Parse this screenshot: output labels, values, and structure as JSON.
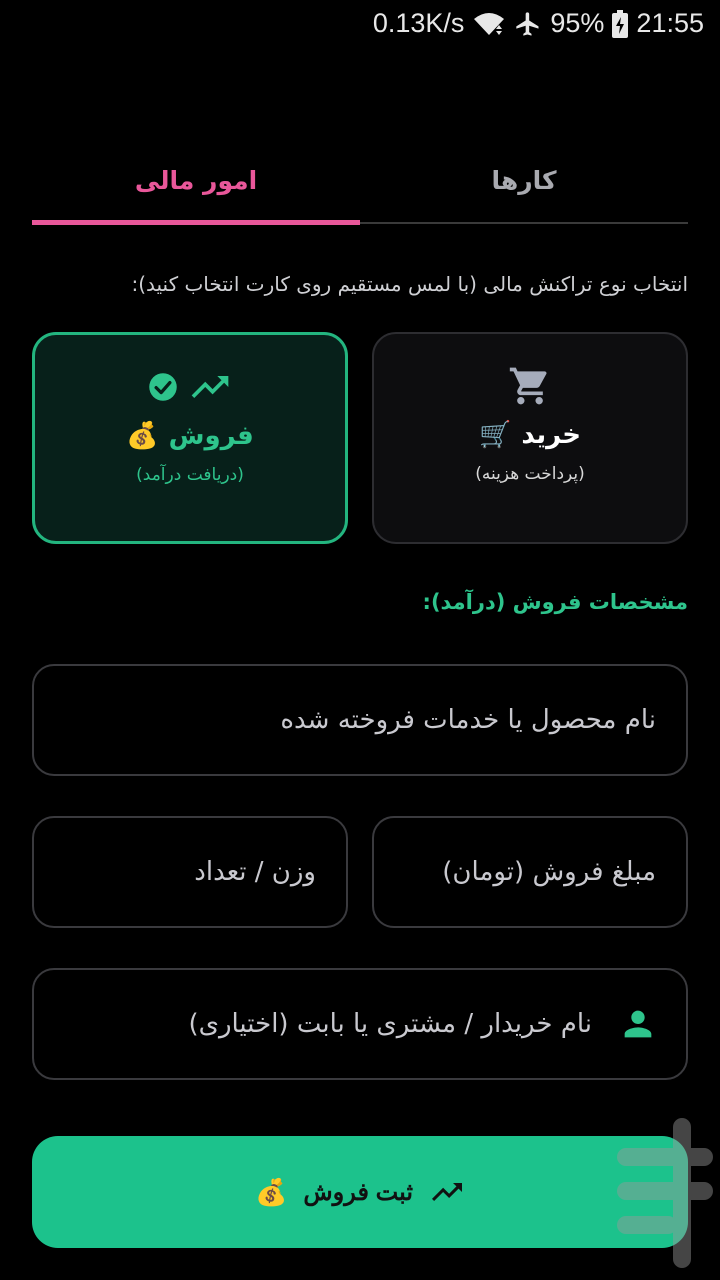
{
  "status_bar": {
    "net_speed": "0.13K/s",
    "battery": "95%",
    "time": "21:55"
  },
  "tabs": [
    {
      "label": "کارها",
      "active": false
    },
    {
      "label": "امور مالی",
      "active": true
    }
  ],
  "instruction": "انتخاب نوع تراکنش مالی (با لمس مستقیم روی کارت انتخاب کنید):",
  "cards": {
    "buy": {
      "title": "خرید",
      "emoji": "🛒",
      "subtitle": "(پرداخت هزینه)",
      "icon": "cart-icon"
    },
    "sell": {
      "title": "فروش",
      "emoji": "💰",
      "subtitle": "(دریافت درآمد)",
      "icon": "trending-up-icon",
      "selected": true
    }
  },
  "section_title": "مشخصات فروش (درآمد):",
  "fields": {
    "product_placeholder": "نام محصول یا خدمات فروخته شده",
    "price_placeholder": "مبلغ فروش (تومان)",
    "weight_placeholder": "وزن / تعداد",
    "buyer_placeholder": "نام خریدار / مشتری یا بابت (اختیاری)"
  },
  "submit": {
    "label": "ثبت فروش",
    "emoji": "💰"
  },
  "colors": {
    "accent_pink": "#e9579a",
    "accent_green": "#1cc28c",
    "background": "#000000"
  }
}
